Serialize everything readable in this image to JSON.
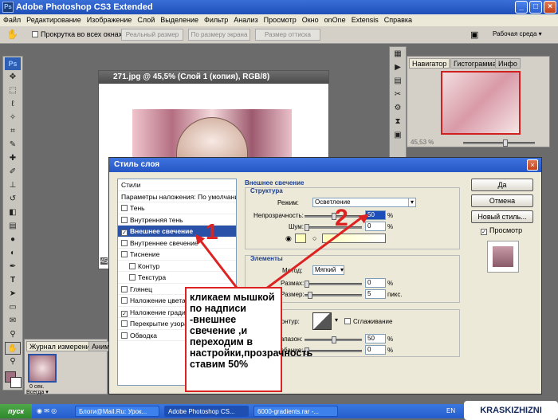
{
  "window": {
    "title": "Adobe Photoshop CS3 Extended",
    "app_icon": "Ps"
  },
  "menu": [
    "Файл",
    "Редактирование",
    "Изображение",
    "Слой",
    "Выделение",
    "Фильтр",
    "Анализ",
    "Просмотр",
    "Окно",
    "onOne",
    "Extensis",
    "Справка"
  ],
  "options": {
    "scroll_all_label": "Прокрутка во всех окнах",
    "btn_actual": "Реальный размер",
    "btn_fit": "По размеру экрана",
    "btn_print": "Размер оттиска",
    "workspace_label": "Рабочая среда ▾"
  },
  "toolbox": {
    "logo": "Ps"
  },
  "document": {
    "title": "271.jpg @ 45,5% (Слой 1 (копия), RGB/8)",
    "zoom_left": "45"
  },
  "navigator": {
    "tabs": [
      "Навигатор",
      "Гистограмма",
      "Инфо"
    ],
    "zoom": "45,53 %"
  },
  "dialog": {
    "title": "Стиль слоя",
    "list_header": "Стили",
    "blend_options": "Параметры наложения: По умолчанию",
    "items": [
      {
        "label": "Тень",
        "checked": false,
        "indent": false,
        "selected": false
      },
      {
        "label": "Внутренняя тень",
        "checked": false,
        "indent": false,
        "selected": false
      },
      {
        "label": "Внешнее свечение",
        "checked": true,
        "indent": false,
        "selected": true
      },
      {
        "label": "Внутреннее свечение",
        "checked": false,
        "indent": false,
        "selected": false
      },
      {
        "label": "Тиснение",
        "checked": false,
        "indent": false,
        "selected": false
      },
      {
        "label": "Контур",
        "checked": false,
        "indent": true,
        "selected": false
      },
      {
        "label": "Текстура",
        "checked": false,
        "indent": true,
        "selected": false
      },
      {
        "label": "Глянец",
        "checked": false,
        "indent": false,
        "selected": false
      },
      {
        "label": "Наложение цвета",
        "checked": false,
        "indent": false,
        "selected": false
      },
      {
        "label": "Наложение градиента",
        "checked": true,
        "indent": false,
        "selected": false
      },
      {
        "label": "Перекрытие узора",
        "checked": false,
        "indent": false,
        "selected": false
      },
      {
        "label": "Обводка",
        "checked": false,
        "indent": false,
        "selected": false
      }
    ],
    "section_title": "Внешнее свечение",
    "structure": {
      "title": "Структура",
      "mode_label": "Режим:",
      "mode_value": "Осветление",
      "opacity_label": "Непрозрачность:",
      "opacity_value": "50",
      "noise_label": "Шум:",
      "noise_value": "0",
      "pct": "%"
    },
    "elements": {
      "title": "Элементы",
      "method_label": "Метод:",
      "method_value": "Мягкий",
      "spread_label": "Размах:",
      "spread_value": "0",
      "size_label": "Размер:",
      "size_value": "5",
      "size_unit": "пикс.",
      "pct": "%"
    },
    "quality": {
      "contour_label": "Контур:",
      "smooth_label": "Сглаживание",
      "range_label": "Диапазон:",
      "range_value": "50",
      "jitter_label": "Колебание:",
      "jitter_value": "0",
      "pct": "%"
    },
    "buttons": {
      "ok": "Да",
      "cancel": "Отмена",
      "new_style": "Новый стиль...",
      "preview": "Просмотр"
    }
  },
  "annotation": {
    "text": "кликаем мышкой по надписи -внешнее свечение ,и переходим в настройки,прозрачность ставим 50%",
    "marker_1": "1",
    "marker_2": "2"
  },
  "layers": {
    "tabs": [
      "Журнал измерений",
      "Анима"
    ],
    "frame_time": "0 сек.",
    "loop": "Всегда ▾"
  },
  "taskbar": {
    "start": "пуск",
    "tasks": [
      "Блоги@Mail.Ru: Урок...",
      "Adobe Photoshop CS...",
      "6000-gradients.rar -..."
    ],
    "lang": "EN",
    "watermark": "KRASKIZHIZNI"
  }
}
